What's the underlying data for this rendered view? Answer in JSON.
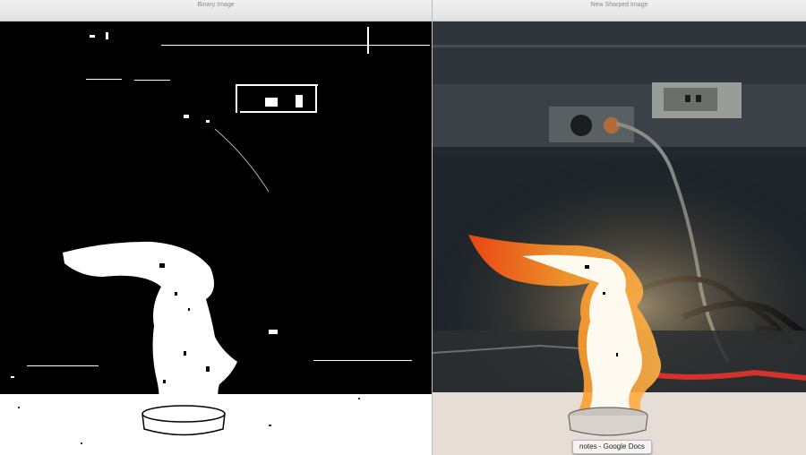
{
  "windows": {
    "left": {
      "title": "Binary Image"
    },
    "right": {
      "title": "New Sharped Image"
    }
  },
  "tooltip": {
    "text": "notes - Google Docs"
  },
  "colors": {
    "flame_core": "#fffaf0",
    "flame_orange": "#ff8a1e",
    "wall": "#2b3238",
    "table": "#e9e2dc"
  }
}
